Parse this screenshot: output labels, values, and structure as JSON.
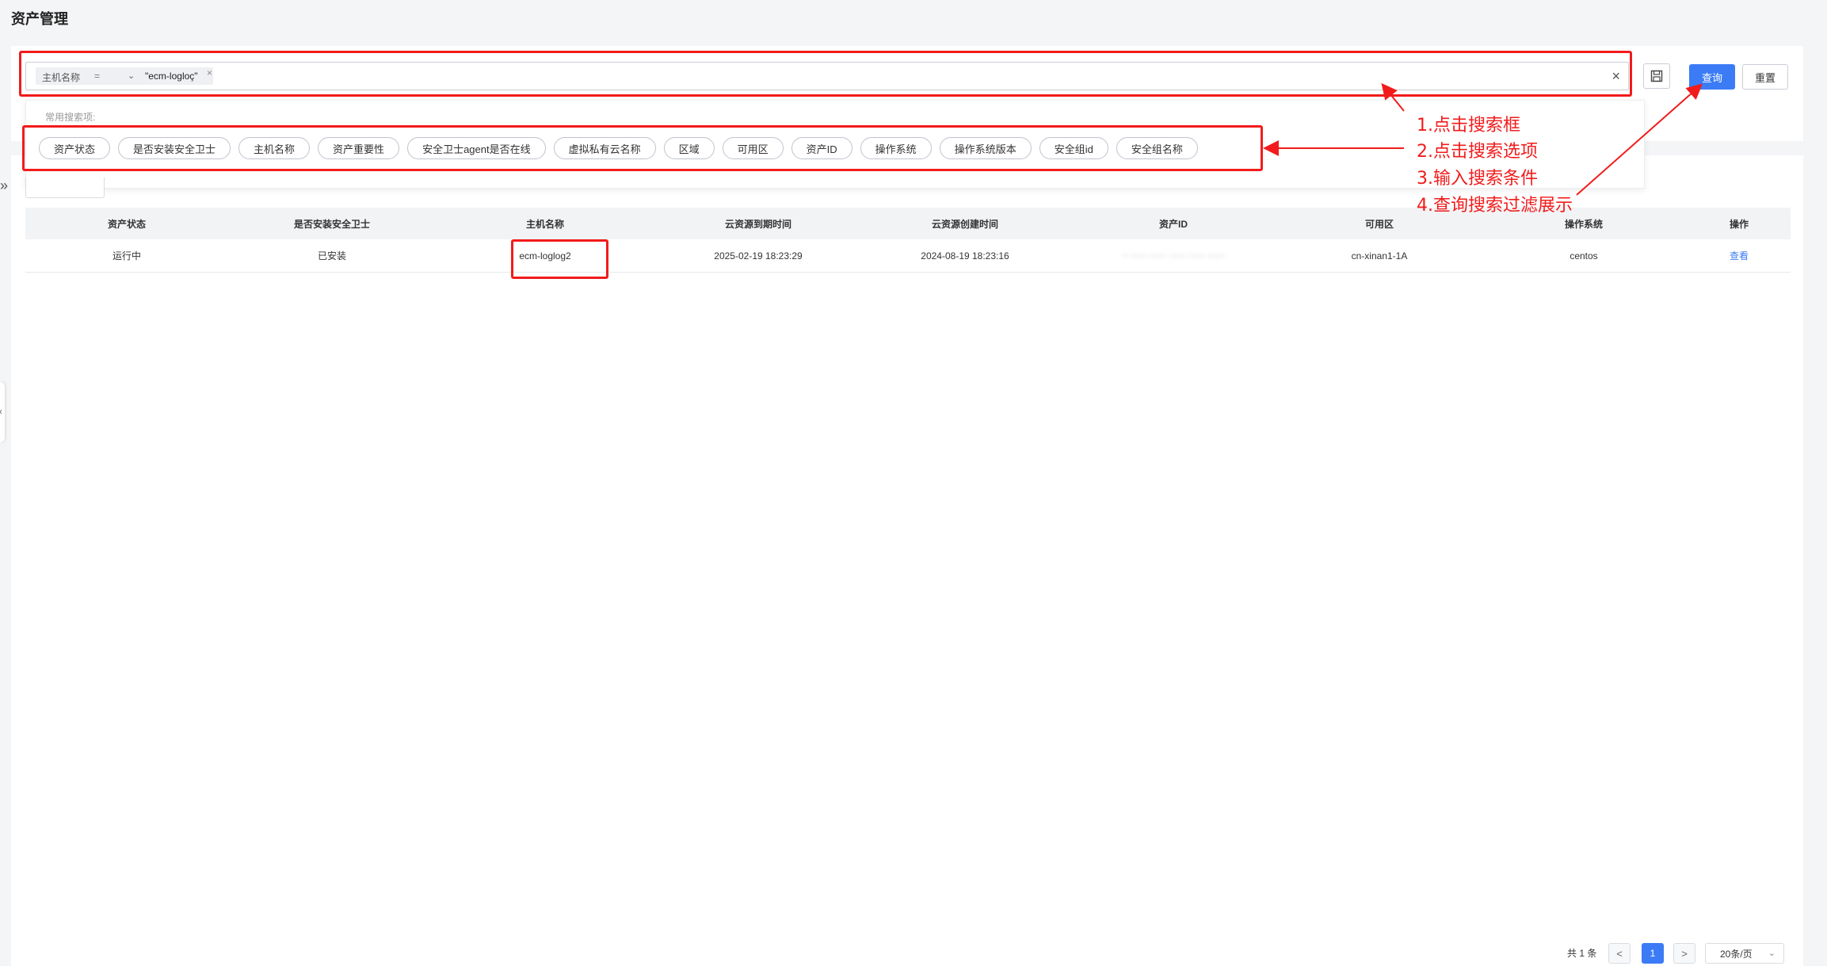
{
  "page": {
    "title": "资产管理"
  },
  "search": {
    "tag_field": "主机名称",
    "tag_operator": "=",
    "tag_value": "\"ecm-logloç\"",
    "tag_remove": "×",
    "clear": "×",
    "query_label": "查询",
    "reset_label": "重置"
  },
  "dropdown": {
    "label": "常用搜索项:",
    "chips": [
      "资产状态",
      "是否安装安全卫士",
      "主机名称",
      "资产重要性",
      "安全卫士agent是否在线",
      "虚拟私有云名称",
      "区域",
      "可用区",
      "资产ID",
      "操作系统",
      "操作系统版本",
      "安全组id",
      "安全组名称"
    ]
  },
  "table": {
    "headers": [
      "资产状态",
      "是否安装安全卫士",
      "主机名称",
      "云资源到期时间",
      "云资源创建时间",
      "资产ID",
      "可用区",
      "操作系统",
      "操作"
    ],
    "rows": [
      {
        "status": "运行中",
        "guard_installed": "已安装",
        "host_name": "ecm-loglog2",
        "expire_time": "2025-02-19 18:23:29",
        "create_time": "2024-08-19 18:23:16",
        "asset_id": "~ ~~~ ~~~ ~~~ ~~~ ~~~",
        "zone": "cn-xinan1-1A",
        "os": "centos",
        "action": "查看"
      }
    ]
  },
  "annotations": {
    "step1": "1.点击搜索框",
    "step2": "2.点击搜索选项",
    "step3": "3.输入搜索条件",
    "step4": "4.查询搜索过滤展示"
  },
  "pagination": {
    "total": "共 1 条",
    "prev": "<",
    "current": "1",
    "next": ">",
    "page_size": "20条/页"
  },
  "colors": {
    "primary": "#3b7cf6",
    "annotation": "#f21b1b"
  }
}
